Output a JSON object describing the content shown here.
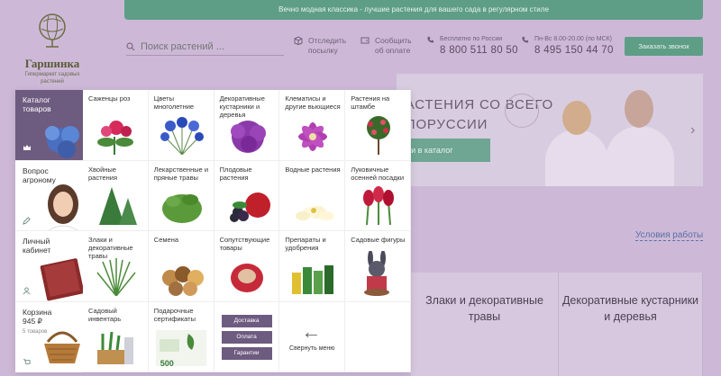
{
  "topbar": {
    "text": "Вечно модная классика - лучшие растения для вашего сада в регулярном стиле"
  },
  "logo": {
    "name": "Гаршинка",
    "tagline": "Гипермаркет садовых растений"
  },
  "search": {
    "placeholder": "Поиск растений ..."
  },
  "header": {
    "track": "Отследить посылку",
    "pay": "Сообщить об оплате",
    "free_label": "Бесплатно по России",
    "free_phone": "8 800 511 80 50",
    "hours_label": "Пн-Вс 8.00-20.00 (по МСК)",
    "hours_phone": "8 495 150 44 70",
    "call_button": "Заказать звонок"
  },
  "banner": {
    "line1": "РАСТЕНИЯ СО ВСЕГО",
    "line2": "ЕЛОРУССИИ",
    "cta": "ти в каталог"
  },
  "link_how": "Условия работы",
  "bottom_categories": [
    "Злаки и декоративные травы",
    "Декоративные кустарники и деревья"
  ],
  "menu": {
    "side": [
      {
        "label": "Каталог товаров",
        "sub": ""
      },
      {
        "label": "Вопрос агроному",
        "sub": ""
      },
      {
        "label": "Личный кабинет",
        "sub": ""
      },
      {
        "label": "Корзина",
        "price": "945 ₽",
        "sub": "5 товаров"
      }
    ],
    "cells": [
      "Саженцы роз",
      "Цветы многолетние",
      "Декоративные кустарники и деревья",
      "Клематисы и другие вьющиеся",
      "Растения на штамбе",
      "Хвойные растения",
      "Лекарственные и пряные травы",
      "Плодовые растения",
      "Водные растения",
      "Луковичные осенней посадки",
      "Злаки и декоративные травы",
      "Семена",
      "Сопутствующие товары",
      "Препараты и удобрения",
      "Садовые фигуры",
      "Садовый инвентарь",
      "Подарочные сертификаты"
    ],
    "info_buttons": [
      "Доставка",
      "Оплата",
      "Гарантии"
    ],
    "collapse": "Свернуть меню",
    "certificate_price": "500"
  },
  "colors": {
    "accent": "#6e5b80",
    "green": "#5e9e86",
    "overlay": "#cdb9d7"
  }
}
